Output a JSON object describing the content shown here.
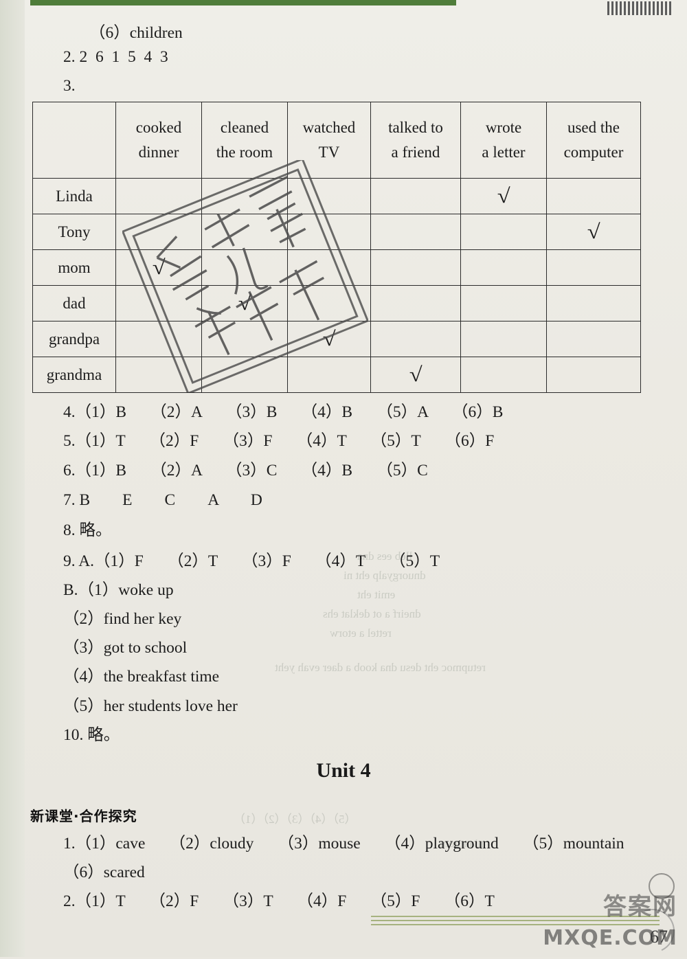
{
  "page": {
    "number": "67",
    "watermark_stamp_text": "参考答案",
    "watermark_brand": "答案网",
    "watermark_site": "MXQE.COM"
  },
  "answers_unit3": {
    "item1_6": "（6）children",
    "item2": "2. 2  6  1  5  4  3",
    "item3_label": "3."
  },
  "table": {
    "headers": [
      "",
      [
        "cooked",
        "dinner"
      ],
      [
        "cleaned",
        "the room"
      ],
      [
        "watched",
        "TV"
      ],
      [
        "talked to",
        "a friend"
      ],
      [
        "wrote",
        "a letter"
      ],
      [
        "used the",
        "computer"
      ]
    ],
    "rows": [
      {
        "label": "Linda",
        "checks": [
          false,
          false,
          false,
          false,
          true,
          false
        ]
      },
      {
        "label": "Tony",
        "checks": [
          false,
          false,
          false,
          false,
          false,
          true
        ]
      },
      {
        "label": "mom",
        "checks": [
          true,
          false,
          false,
          false,
          false,
          false
        ]
      },
      {
        "label": "dad",
        "checks": [
          false,
          true,
          false,
          false,
          false,
          false
        ]
      },
      {
        "label": "grandpa",
        "checks": [
          false,
          false,
          true,
          false,
          false,
          false
        ]
      },
      {
        "label": "grandma",
        "checks": [
          false,
          false,
          false,
          true,
          false,
          false
        ]
      }
    ],
    "check_glyph": "√"
  },
  "lines": [
    "4.（1）B　　（2）A　　（3）B　　（4）B　　（5）A　　（6）B",
    "5.（1）T　　（2）F　　（3）F　　（4）T　　（5）T　　（6）F",
    "6.（1）B　　（2）A　　（3）C　　（4）B　　（5）C",
    "7. B　　E　　C　　A　　D",
    "8. 略。",
    "9. A.（1）F　　（2）T　　（3）F　　（4）T　　（5）T",
    "B.（1）woke up",
    "（2）find her key",
    "（3）got to school",
    "（4）the breakfast time",
    "（5）her students love her",
    "10. 略。"
  ],
  "unit4": {
    "title": "Unit 4",
    "section_label": "新课堂·合作探究",
    "lines": [
      "1.（1）cave　　（2）cloudy　　（3）mouse　　（4）playground　　（5）mountain",
      "（6）scared",
      "2.（1）T　　（2）F　　（3）T　　（4）F　　（5）F　　（6）T"
    ]
  }
}
